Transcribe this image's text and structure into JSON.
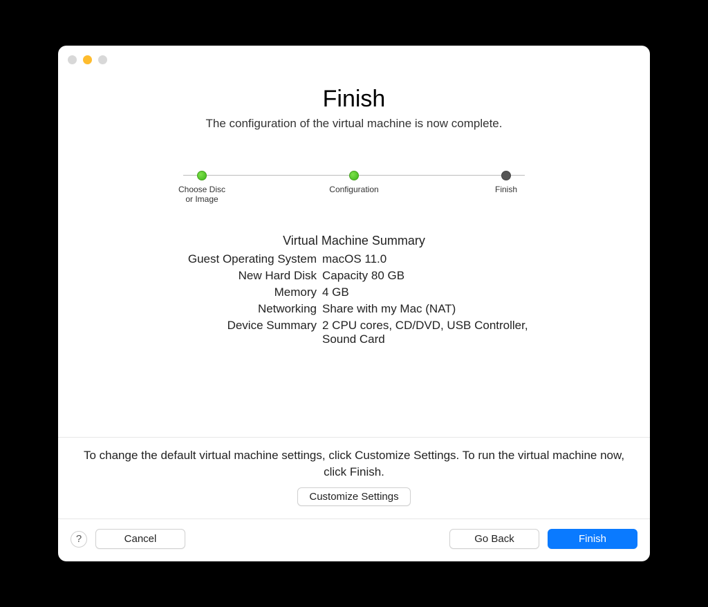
{
  "header": {
    "title": "Finish",
    "subtitle": "The configuration of the virtual machine is now complete."
  },
  "stepper": {
    "steps": [
      {
        "label": "Choose Disc\nor Image",
        "state": "done"
      },
      {
        "label": "Configuration",
        "state": "done"
      },
      {
        "label": "Finish",
        "state": "current"
      }
    ]
  },
  "summary": {
    "title": "Virtual Machine Summary",
    "rows": [
      {
        "key": "Guest Operating System",
        "value": "macOS 11.0"
      },
      {
        "key": "New Hard Disk",
        "value": "Capacity 80 GB"
      },
      {
        "key": "Memory",
        "value": "4 GB"
      },
      {
        "key": "Networking",
        "value": "Share with my Mac (NAT)"
      },
      {
        "key": "Device Summary",
        "value": "2 CPU cores, CD/DVD, USB Controller, Sound Card"
      }
    ]
  },
  "customize": {
    "text": "To change the default virtual machine settings, click Customize Settings. To run the virtual machine now, click Finish.",
    "button": "Customize Settings"
  },
  "footer": {
    "help": "?",
    "cancel": "Cancel",
    "back": "Go Back",
    "finish": "Finish"
  }
}
